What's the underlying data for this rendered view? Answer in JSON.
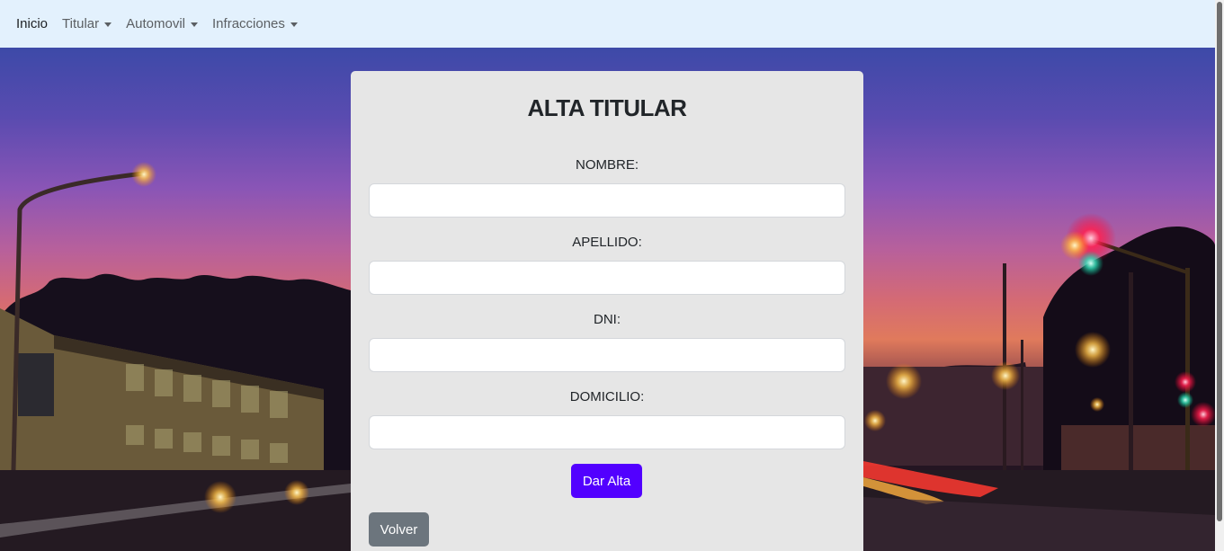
{
  "navbar": {
    "items": [
      {
        "label": "Inicio"
      },
      {
        "label": "Titular"
      },
      {
        "label": "Automovil"
      },
      {
        "label": "Infracciones"
      }
    ]
  },
  "form": {
    "title": "ALTA TITULAR",
    "fields": [
      {
        "label": "NOMBRE:",
        "value": "",
        "placeholder": ""
      },
      {
        "label": "APELLIDO:",
        "value": "",
        "placeholder": ""
      },
      {
        "label": "DNI:",
        "value": "",
        "placeholder": ""
      },
      {
        "label": "DOMICILIO:",
        "value": "",
        "placeholder": ""
      }
    ],
    "submit_label": "Dar Alta",
    "back_label": "Volver"
  },
  "colors": {
    "navbar_bg": "#e3f1fd",
    "card_bg": "#e6e6e6",
    "submit_button": "#5200ff",
    "back_button": "#6c757d"
  },
  "icons": {
    "dropdown": "caret-down-icon"
  }
}
